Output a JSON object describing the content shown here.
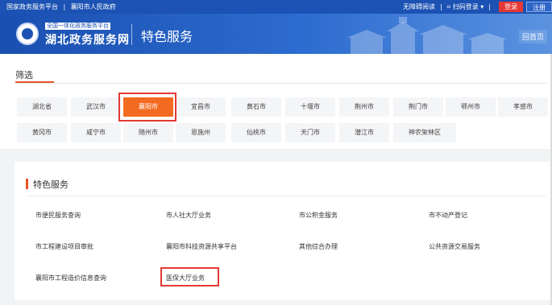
{
  "topbar": {
    "links": [
      "国家政务服务平台",
      "|",
      "襄阳市人民政府"
    ],
    "accessibility": "无障碍阅读",
    "scan_login": "扫码登录 ▾",
    "login": "登录",
    "register": "注册"
  },
  "header": {
    "logo_small": "全国一体化政务服务平台",
    "logo_big": "湖北政务服务网",
    "title": "特色服务",
    "home": "回首页"
  },
  "filter": {
    "title": "筛选",
    "row1": [
      "湖北省",
      "武汉市",
      "襄阳市",
      "宜昌市",
      "黄石市",
      "十堰市",
      "荆州市",
      "荆门市",
      "鄂州市",
      "孝感市"
    ],
    "row2": [
      "黄冈市",
      "咸宁市",
      "随州市",
      "恩施州",
      "仙桃市",
      "天门市",
      "潜江市",
      "神农架林区"
    ],
    "selected": "襄阳市"
  },
  "services": {
    "title": "特色服务",
    "items": [
      "市便民服务查询",
      "市人社大厅业务",
      "市公积金服务",
      "市不动产登记",
      "市工程建设项目审批",
      "襄阳市科技资源共享平台",
      "其他综合办理",
      "公共资源交易服务",
      "襄阳市工程造价信息查询",
      "医保大厅业务"
    ]
  },
  "colors": {
    "brand": "#1b52b3",
    "accent": "#f36b20",
    "highlight": "#e53935"
  }
}
